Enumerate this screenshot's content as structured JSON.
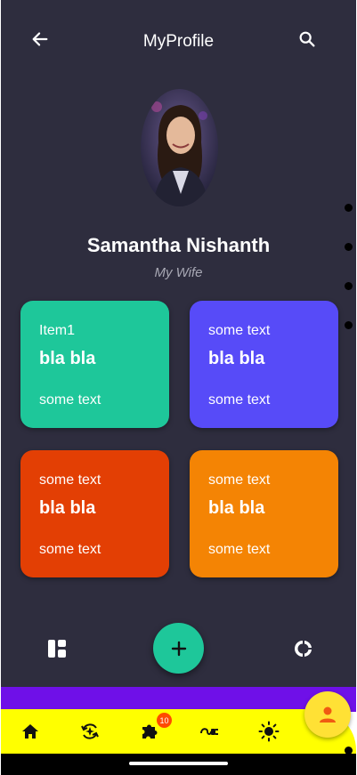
{
  "header": {
    "title": "MyProfile",
    "back_icon": "arrow-left-icon",
    "search_icon": "search-icon"
  },
  "profile": {
    "name": "Samantha Nishanth",
    "subtitle": "My Wife"
  },
  "cards": [
    {
      "top": "Item1",
      "middle": "bla bla",
      "bottom": "some text",
      "color": "#1ec79a"
    },
    {
      "top": "some text",
      "middle": "bla bla",
      "bottom": "some text",
      "color": "#574bf8"
    },
    {
      "top": "some text",
      "middle": "bla bla",
      "bottom": "some text",
      "color": "#e33f04"
    },
    {
      "top": "some text",
      "middle": "bla bla",
      "bottom": "some text",
      "color": "#f48404"
    }
  ],
  "toolbar": {
    "left_icon": "dashboard-icon",
    "center_icon": "plus-icon",
    "right_icon": "donut-chart-icon"
  },
  "bottom_nav": {
    "items": [
      "home-icon",
      "refresh-sparkle-icon",
      "puzzle-icon",
      "plug-icon",
      "sun-icon"
    ],
    "badge_count": "10",
    "profile_button_icon": "person-icon"
  },
  "colors": {
    "background": "#2e2d3e",
    "nav": "#ffff00",
    "band": "#6f10e8",
    "badge": "#ff4a00",
    "fab": "#1ec79a",
    "profile_fab": "#ffe135"
  }
}
